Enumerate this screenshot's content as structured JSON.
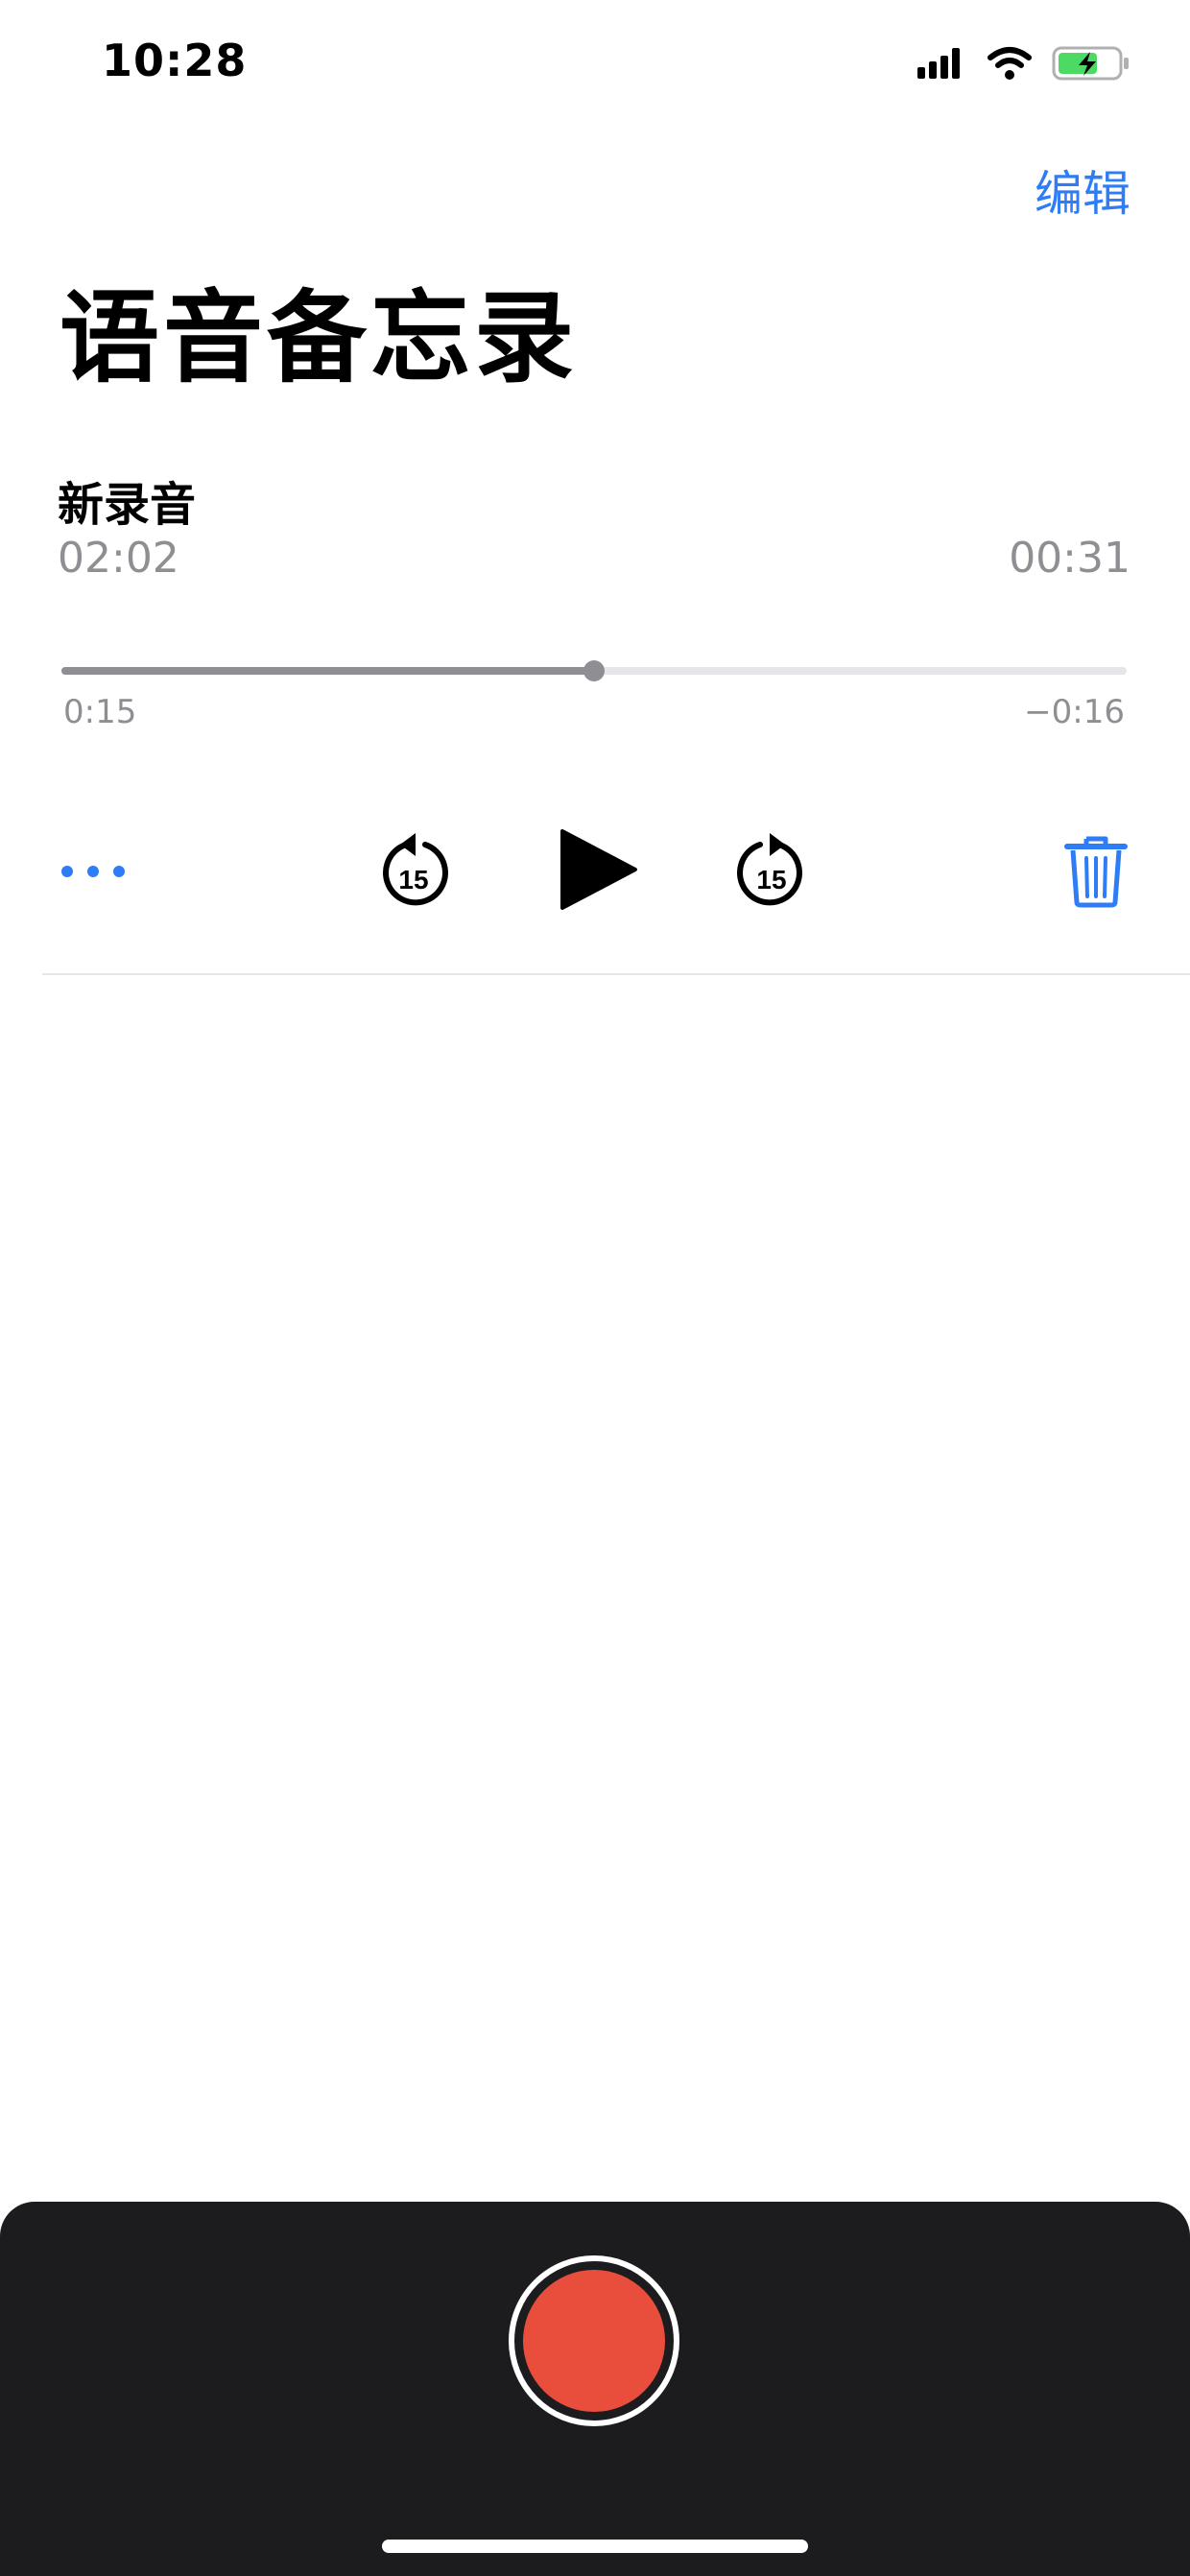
{
  "status_bar": {
    "time": "10:28",
    "icons": [
      "cellular-signal-icon",
      "wifi-icon",
      "battery-charging-icon"
    ],
    "battery_color": "#4cd964"
  },
  "header": {
    "edit_label": "编辑",
    "title": "语音备忘录"
  },
  "recording": {
    "title": "新录音",
    "time": "02:02",
    "duration": "00:31",
    "progress": 0.5,
    "elapsed": "0:15",
    "remaining": "−0:16"
  },
  "controls": {
    "icons": [
      "more-icon",
      "skip-back-15-icon",
      "play-icon",
      "skip-forward-15-icon",
      "trash-icon"
    ],
    "skip_seconds": "15"
  },
  "colors": {
    "accent": "#2f7df6",
    "record": "#e94e3d",
    "panel": "#1c1c1e",
    "secondary_text": "#8e8e93"
  }
}
